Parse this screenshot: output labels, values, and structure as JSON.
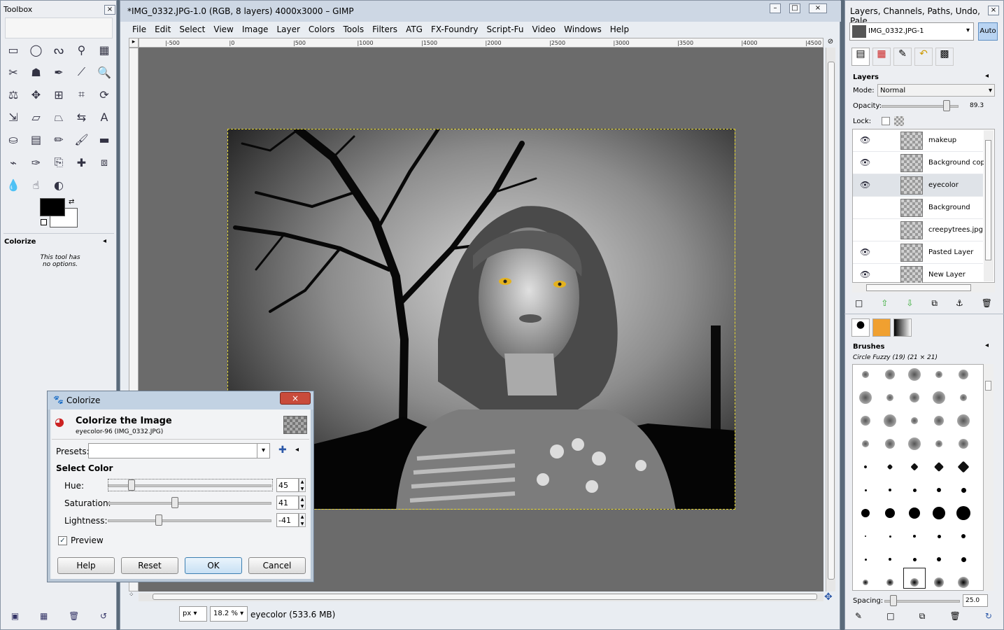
{
  "toolbox": {
    "title": "Toolbox",
    "options_title": "Colorize",
    "options_text": "This tool has no options."
  },
  "image_window": {
    "title": "*IMG_0332.JPG-1.0 (RGB, 8 layers) 4000x3000 – GIMP",
    "menu": [
      "File",
      "Edit",
      "Select",
      "View",
      "Image",
      "Layer",
      "Colors",
      "Tools",
      "Filters",
      "ATG",
      "FX-Foundry",
      "Script-Fu",
      "Video",
      "Windows",
      "Help"
    ],
    "ruler_ticks": [
      "-500",
      "0",
      "500",
      "1000",
      "1500",
      "2000",
      "2500",
      "3000",
      "3500",
      "4000",
      "4500"
    ],
    "unit": "px",
    "zoom": "18.2 %",
    "status": "eyecolor (533.6 MB)"
  },
  "dock": {
    "title": "Layers, Channels, Paths, Undo, Pale...",
    "image_select": "IMG_0332.JPG-1",
    "auto_label": "Auto",
    "layers_title": "Layers",
    "mode_label": "Mode:",
    "mode_value": "Normal",
    "opacity_label": "Opacity:",
    "opacity_value": "89.3",
    "opacity_fraction": 0.893,
    "lock_label": "Lock:",
    "layers": [
      {
        "name": "makeup",
        "visible": true
      },
      {
        "name": "Background copy",
        "visible": true
      },
      {
        "name": "eyecolor",
        "visible": true
      },
      {
        "name": "Background",
        "visible": false
      },
      {
        "name": "creepytrees.jpg",
        "visible": false
      },
      {
        "name": "Pasted Layer",
        "visible": true
      },
      {
        "name": "New Layer",
        "visible": true
      }
    ],
    "brushes_title": "Brushes",
    "brush_name": "Circle Fuzzy (19) (21 × 21)",
    "spacing_label": "Spacing:",
    "spacing_value": "25.0"
  },
  "dialog": {
    "title": "Colorize",
    "heading": "Colorize the Image",
    "subheading": "eyecolor-96 (IMG_0332.JPG)",
    "presets_label": "Presets:",
    "section": "Select Color",
    "hue_label": "Hue:",
    "hue_value": "45",
    "saturation_label": "Saturation:",
    "saturation_value": "41",
    "lightness_label": "Lightness:",
    "lightness_value": "-41",
    "preview_label": "Preview",
    "help_label": "Help",
    "reset_label": "Reset",
    "ok_label": "OK",
    "cancel_label": "Cancel"
  }
}
